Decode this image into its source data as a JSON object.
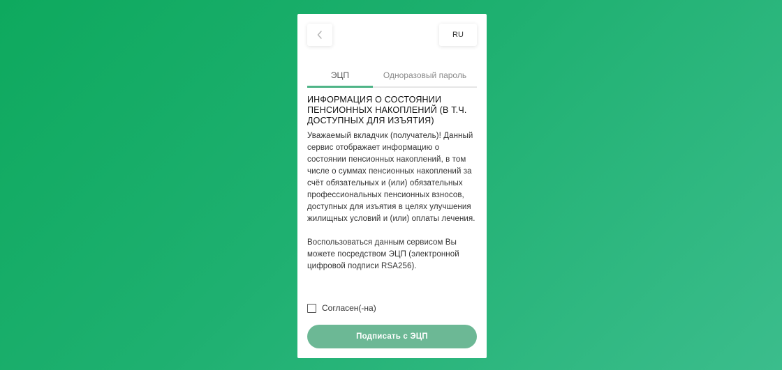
{
  "header": {
    "back_icon": "chevron-left-icon",
    "language": "RU"
  },
  "tabs": [
    {
      "label": "ЭЦП",
      "active": true
    },
    {
      "label": "Одноразовый пароль",
      "active": false
    }
  ],
  "info": {
    "title": "ИНФОРМАЦИЯ О СОСТОЯНИИ ПЕНСИОННЫХ НАКОПЛЕНИЙ (В Т.Ч. ДОСТУПНЫХ ДЛЯ ИЗЪЯТИЯ)",
    "paragraph1": "Уважаемый вкладчик (получатель)! Данный сервис отображает информацию о состоянии пенсионных накоплений, в том числе о суммах пенсионных накоплений за счёт обязательных и (или) обязательных профессиональных пенсионных взносов, доступных для изъятия в целях улучшения жилищных условий и (или) оплаты лечения.",
    "paragraph2": "Воспользоваться данным сервисом Вы можете посредством ЭЦП (электронной цифровой подписи RSA256)."
  },
  "agreement": {
    "label": "Согласен(-на)",
    "checked": false
  },
  "actions": {
    "sign_label": "Подписать с ЭЦП",
    "sign_color": "#6cb895"
  },
  "colors": {
    "accent": "#4fb487",
    "background_start": "#0ea95e",
    "background_end": "#3bbd8c"
  }
}
